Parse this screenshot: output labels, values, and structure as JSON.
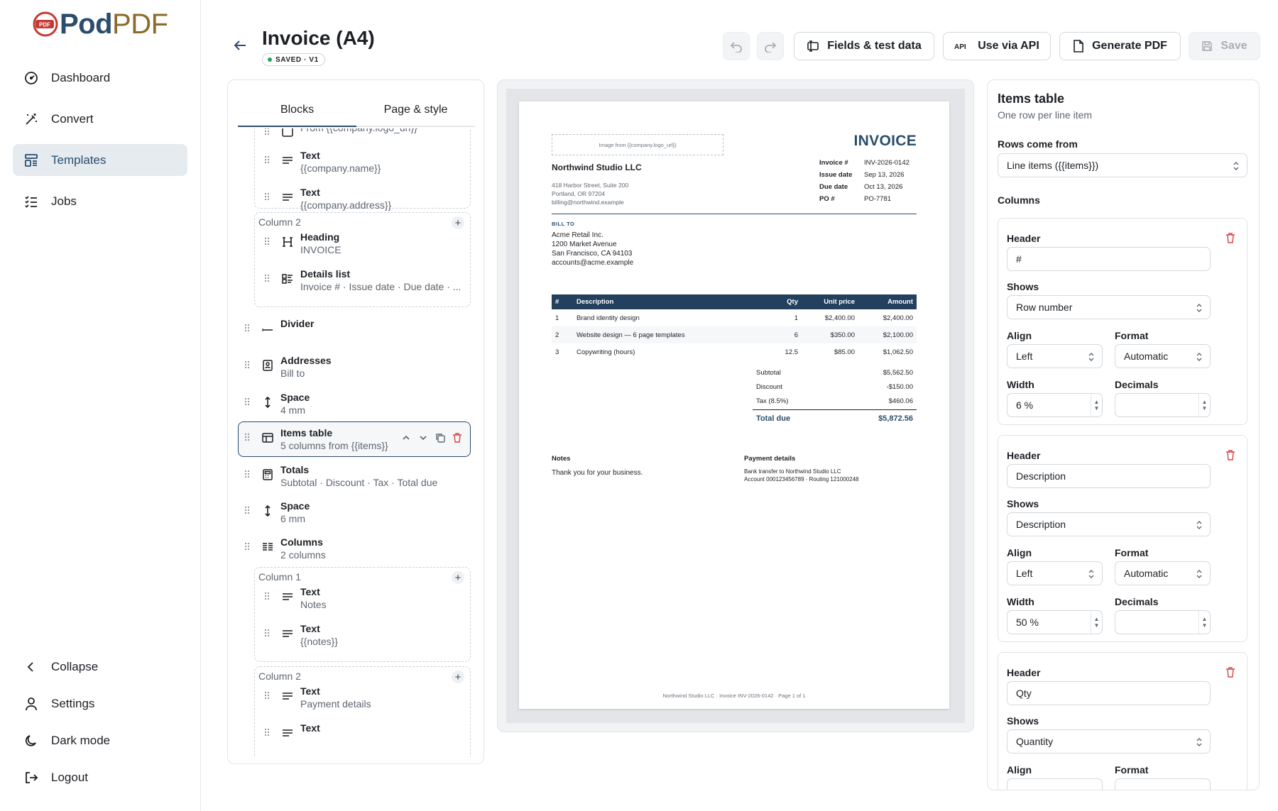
{
  "brand": {
    "pod": "Pod",
    "pdf": "PDF",
    "mark": "PDF"
  },
  "nav": {
    "items": [
      {
        "label": "Dashboard",
        "icon": "gauge-icon"
      },
      {
        "label": "Convert",
        "icon": "wand-icon"
      },
      {
        "label": "Templates",
        "icon": "template-icon",
        "active": true
      },
      {
        "label": "Jobs",
        "icon": "checklist-icon"
      }
    ],
    "bottom": [
      {
        "label": "Collapse",
        "icon": "chevron-left-icon"
      },
      {
        "label": "Settings",
        "icon": "user-icon"
      },
      {
        "label": "Dark mode",
        "icon": "moon-icon"
      },
      {
        "label": "Logout",
        "icon": "logout-icon"
      }
    ]
  },
  "header": {
    "title": "Invoice (A4)",
    "badge": "SAVED · V1",
    "fields_button": "Fields & test data",
    "api_button": "Use via API",
    "generate_button": "Generate PDF",
    "save_button": "Save"
  },
  "left_panel": {
    "tabs": [
      "Blocks",
      "Page & style"
    ],
    "blocks": [
      {
        "name": "",
        "sub": "From {{company.logo_url}}"
      },
      {
        "name": "Text",
        "sub": "{{company.name}}"
      },
      {
        "name": "Text",
        "sub": "{{company.address}}"
      },
      {
        "col": "Column 2"
      },
      {
        "name": "Heading",
        "sub": "INVOICE"
      },
      {
        "name": "Details list",
        "sub": "Invoice # · Issue date · Due date · ..."
      },
      {
        "name": "Divider",
        "sub": ""
      },
      {
        "name": "Addresses",
        "sub": "Bill to"
      },
      {
        "name": "Space",
        "sub": "4 mm"
      },
      {
        "name": "Items table",
        "sub": "5 columns from {{items}}"
      },
      {
        "name": "Totals",
        "sub": "Subtotal · Discount · Tax · Total due"
      },
      {
        "name": "Space",
        "sub": "6 mm"
      },
      {
        "name": "Columns",
        "sub": "2 columns"
      },
      {
        "col": "Column 1"
      },
      {
        "name": "Text",
        "sub": "Notes"
      },
      {
        "name": "Text",
        "sub": "{{notes}}"
      },
      {
        "col": "Column 2"
      },
      {
        "name": "Text",
        "sub": "Payment details"
      },
      {
        "name": "Text",
        "sub": ""
      }
    ]
  },
  "preview": {
    "image_placeholder": "Image from {{company.logo_url}}",
    "company": "Northwind Studio LLC",
    "company_address": [
      "418 Harbor Street, Suite 200",
      "Portland, OR 97204",
      "billing@northwind.example"
    ],
    "doc_title": "INVOICE",
    "meta": [
      {
        "k": "Invoice #",
        "v": "INV-2026-0142"
      },
      {
        "k": "Issue date",
        "v": "Sep 13, 2026"
      },
      {
        "k": "Due date",
        "v": "Oct 13, 2026"
      },
      {
        "k": "PO #",
        "v": "PO-7781"
      }
    ],
    "bill_to_label": "BILL TO",
    "bill_to": [
      "Acme Retail Inc.",
      "1200 Market Avenue",
      "San Francisco, CA 94103",
      "accounts@acme.example"
    ],
    "table_headers": [
      "#",
      "Description",
      "Qty",
      "Unit price",
      "Amount"
    ],
    "rows": [
      [
        "1",
        "Brand identity design",
        "1",
        "$2,400.00",
        "$2,400.00"
      ],
      [
        "2",
        "Website design — 6 page templates",
        "6",
        "$350.00",
        "$2,100.00"
      ],
      [
        "3",
        "Copywriting (hours)",
        "12.5",
        "$85.00",
        "$1,062.50"
      ]
    ],
    "totals": [
      {
        "k": "Subtotal",
        "v": "$5,562.50"
      },
      {
        "k": "Discount",
        "v": "-$150.00"
      },
      {
        "k": "Tax (8.5%)",
        "v": "$460.06"
      }
    ],
    "total_due": {
      "k": "Total due",
      "v": "$5,872.56"
    },
    "notes_label": "Notes",
    "notes": "Thank you for your business.",
    "payment_label": "Payment details",
    "payment": [
      "Bank transfer to Northwind Studio LLC",
      "Account 000123456789 · Routing 121000248"
    ],
    "footer": "Northwind Studio LLC · Invoice INV-2026-0142 · Page 1 of 1"
  },
  "right_panel": {
    "title": "Items table",
    "subtitle": "One row per line item",
    "rows_label": "Rows come from",
    "rows_value": "Line items ({{items}})",
    "columns_label": "Columns",
    "labels": {
      "header": "Header",
      "shows": "Shows",
      "align": "Align",
      "format": "Format",
      "width": "Width",
      "decimals": "Decimals"
    },
    "columns": [
      {
        "header": "#",
        "shows": "Row number",
        "align": "Left",
        "format": "Automatic",
        "width": "6 %",
        "decimals": ""
      },
      {
        "header": "Description",
        "shows": "Description",
        "align": "Left",
        "format": "Automatic",
        "width": "50 %",
        "decimals": ""
      },
      {
        "header": "Qty",
        "shows": "Quantity",
        "align": "",
        "format": "",
        "width": "",
        "decimals": ""
      }
    ]
  }
}
